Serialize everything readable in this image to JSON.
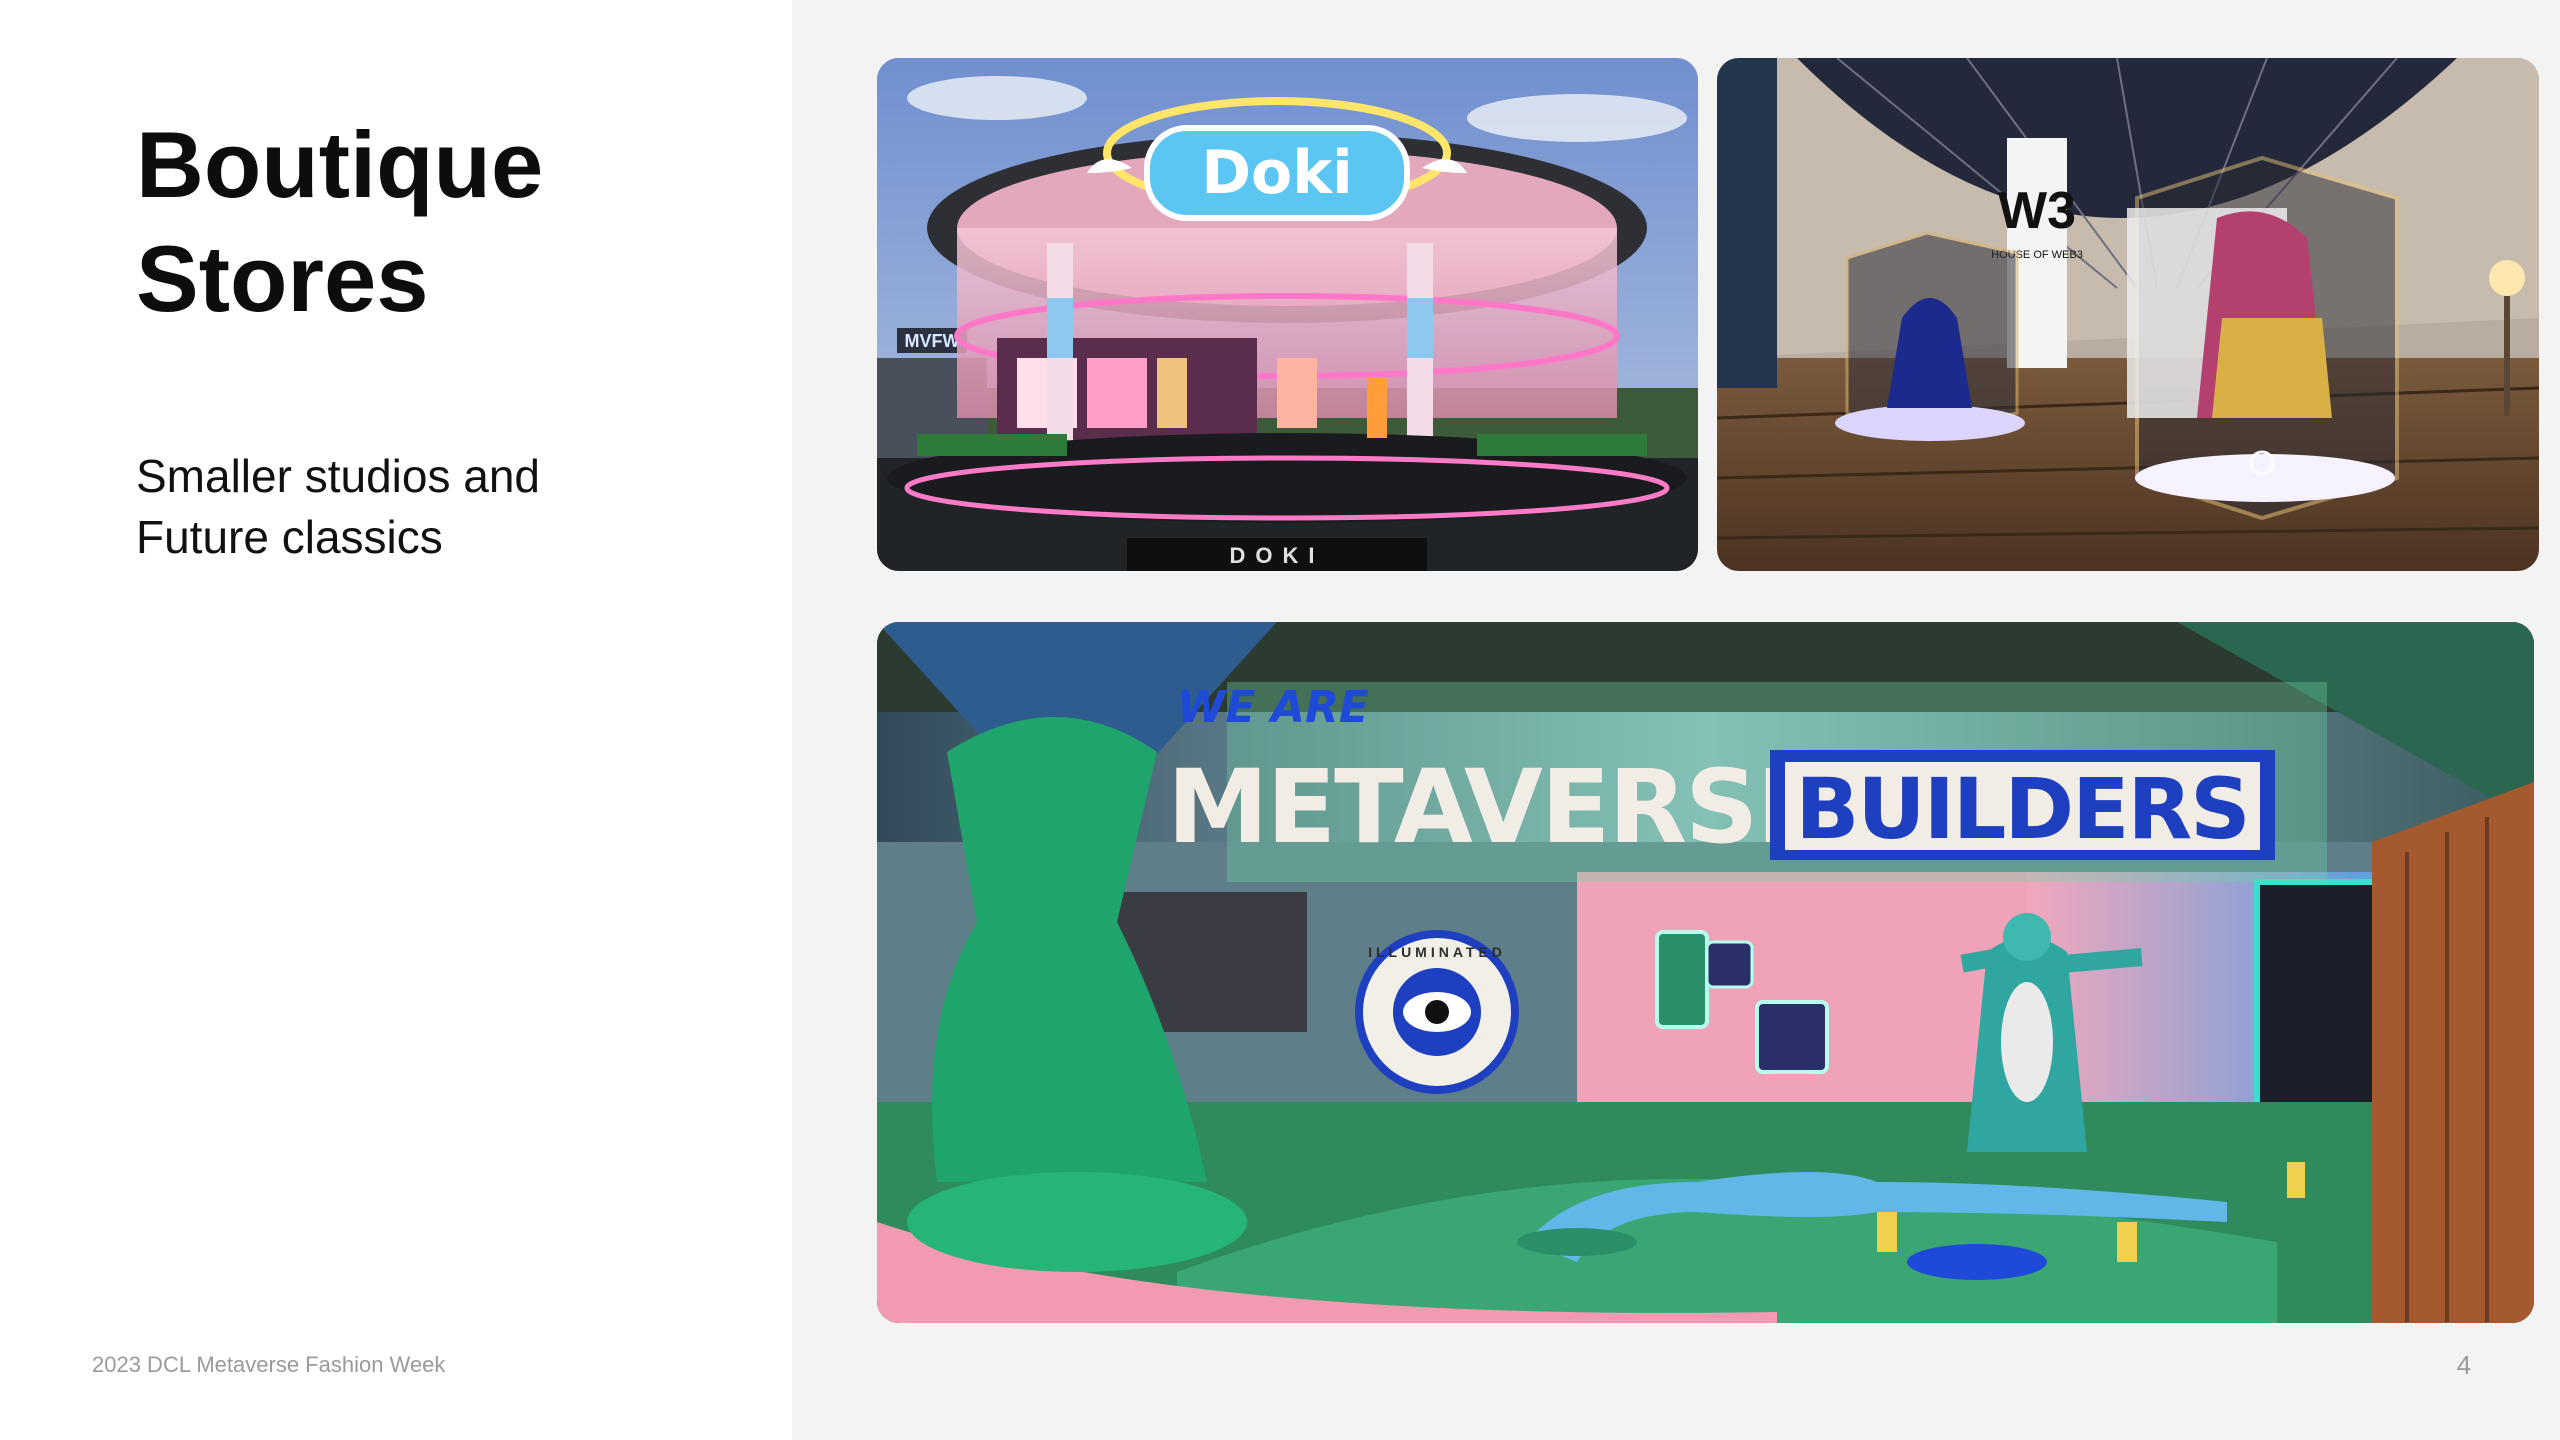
{
  "slide": {
    "title": "Boutique\nStores",
    "title_line1": "Boutique",
    "title_line2": "Stores",
    "subtitle_line1": "Smaller studios and",
    "subtitle_line2": "Future classics",
    "footer": "2023 DCL Metaverse Fashion Week",
    "page_number": "4"
  },
  "images": {
    "doki": {
      "sign": "Doki",
      "floor_sign": "DOKI",
      "side_sign": "MVFW"
    },
    "w3": {
      "banner": "W3",
      "banner_sub": "HOUSE OF WEB3"
    },
    "builders": {
      "line1": "WE ARE",
      "word1": "METAVERSE",
      "word2": "BUILDERS",
      "badge": "ILLUMINATED"
    }
  },
  "colors": {
    "left_background": "#ffffff",
    "right_background": "#f3f3f3",
    "title": "#0d0d0d",
    "footer": "#9a9a9a"
  }
}
